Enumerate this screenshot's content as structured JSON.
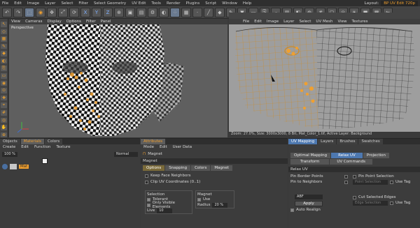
{
  "menubar": {
    "items": [
      "File",
      "Edit",
      "Image",
      "Layer",
      "Select",
      "Filter",
      "Select Geometry",
      "UV Edit",
      "Tools",
      "Render",
      "Plugins",
      "Script",
      "Window",
      "Help"
    ],
    "layout_label": "Layout:",
    "layout_value": "BP UV Edit 720p"
  },
  "viewport": {
    "menu": [
      "View",
      "Cameras",
      "Display",
      "Options",
      "Filter",
      "Panel"
    ],
    "label": "Perspective"
  },
  "uv_editor": {
    "menu": [
      "File",
      "Edit",
      "Image",
      "Layer",
      "Select",
      "UV Mesh",
      "View",
      "Textures"
    ],
    "status": "Zoom: 27.0%, Size: 3000x3000, 8 Bit, Mat_Color_1.tif, Active Layer: Background"
  },
  "objects_panel": {
    "tabs": [
      "Objects",
      "Materials",
      "Colors"
    ],
    "menu": [
      "Create",
      "Edit",
      "Function",
      "Texture"
    ],
    "zoom": "100 %",
    "mode": "Normal",
    "material": "Mat"
  },
  "attributes": {
    "tab": "Attributes",
    "menu": [
      "Mode",
      "Edit",
      "User Data"
    ],
    "title": "Magnet",
    "section": "Magnet",
    "subtabs": [
      "Options",
      "Snapping",
      "Colors",
      "Magnet"
    ],
    "keep_faces": "Keep Face Neighbors",
    "clip_uv": "Clip UV Coordinates (0..1)",
    "selection_label": "Selection",
    "tolerant": "Tolerant",
    "only_visible": "Only Visible Elements",
    "live_label": "Live",
    "live_value": "10",
    "magnet_group": "Magnet",
    "use": "Use",
    "radius_label": "Radius",
    "radius_value": "20 %"
  },
  "uv_panel": {
    "tabs": [
      "UV Mapping",
      "Layers",
      "Brushes",
      "Swatches"
    ],
    "subtabs_row1": [
      "Optimal Mapping",
      "Relax UV",
      "Projection"
    ],
    "subtabs_row2": [
      "Transform",
      "UV Commands"
    ],
    "heading": "Relax UV",
    "pin_border": "Pin Border Points",
    "pin_neighbors": "Pin to Neighbors",
    "pin_point_sel": "Pin Point Selection",
    "point_selection": "Point Selection",
    "use_tag": "Use Tag",
    "method": "ABF",
    "apply": "Apply",
    "auto_realign": "Auto Realign",
    "cut_edges": "Cut Selected Edges",
    "edge_selection": "Edge Selection",
    "use_tag2": "Use Tag"
  },
  "colors": {
    "accent": "#f0a030",
    "highlight": "#4d78b0"
  }
}
